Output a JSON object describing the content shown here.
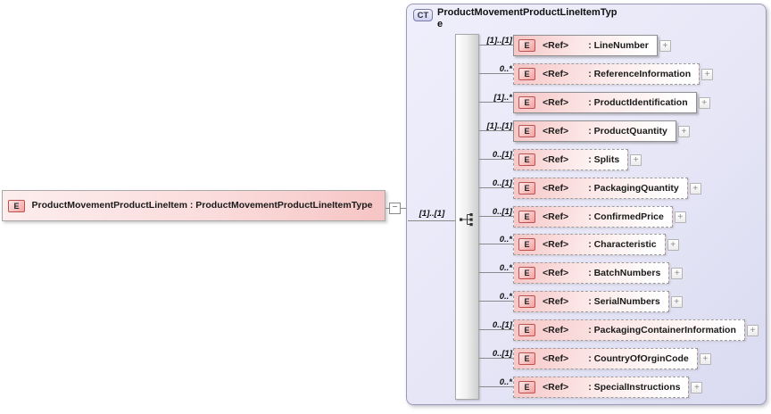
{
  "icons": {
    "plus": "+",
    "minus": "−",
    "compositor": "sequence-icon"
  },
  "colors": {
    "element_fill": "#f6c4c4",
    "element_badge_border": "#c0504d",
    "container_fill": "#e6e6f7",
    "container_border": "#9a9ab5",
    "connector": "#8a8a8a"
  },
  "root_element": {
    "badge": "E",
    "display": "ProductMovementProductLineItem : ProductMovementProductLineItemType"
  },
  "entry_cardinality": "[1]..[1]",
  "complex_type": {
    "badge": "CT",
    "title": "ProductMovementProductLineItemType",
    "compositor": "sequence",
    "children": [
      {
        "badge": "E",
        "ref": "<Ref>",
        "display_name": ": LineNumber",
        "cardinality": "[1]..[1]",
        "required": true
      },
      {
        "badge": "E",
        "ref": "<Ref>",
        "display_name": ": ReferenceInformation",
        "cardinality": "0..*",
        "required": false
      },
      {
        "badge": "E",
        "ref": "<Ref>",
        "display_name": ": ProductIdentification",
        "cardinality": "[1]..*",
        "required": true
      },
      {
        "badge": "E",
        "ref": "<Ref>",
        "display_name": ": ProductQuantity",
        "cardinality": "[1]..[1]",
        "required": true
      },
      {
        "badge": "E",
        "ref": "<Ref>",
        "display_name": ": Splits",
        "cardinality": "0..[1]",
        "required": false
      },
      {
        "badge": "E",
        "ref": "<Ref>",
        "display_name": ": PackagingQuantity",
        "cardinality": "0..[1]",
        "required": false
      },
      {
        "badge": "E",
        "ref": "<Ref>",
        "display_name": ": ConfirmedPrice",
        "cardinality": "0..[1]",
        "required": false
      },
      {
        "badge": "E",
        "ref": "<Ref>",
        "display_name": ": Characteristic",
        "cardinality": "0..*",
        "required": false
      },
      {
        "badge": "E",
        "ref": "<Ref>",
        "display_name": ": BatchNumbers",
        "cardinality": "0..*",
        "required": false
      },
      {
        "badge": "E",
        "ref": "<Ref>",
        "display_name": ": SerialNumbers",
        "cardinality": "0..*",
        "required": false
      },
      {
        "badge": "E",
        "ref": "<Ref>",
        "display_name": ": PackagingContainerInformation",
        "cardinality": "0..[1]",
        "required": false
      },
      {
        "badge": "E",
        "ref": "<Ref>",
        "display_name": ": CountryOfOrginCode",
        "cardinality": "0..[1]",
        "required": false
      },
      {
        "badge": "E",
        "ref": "<Ref>",
        "display_name": ": SpecialInstructions",
        "cardinality": "0..*",
        "required": false
      }
    ]
  }
}
